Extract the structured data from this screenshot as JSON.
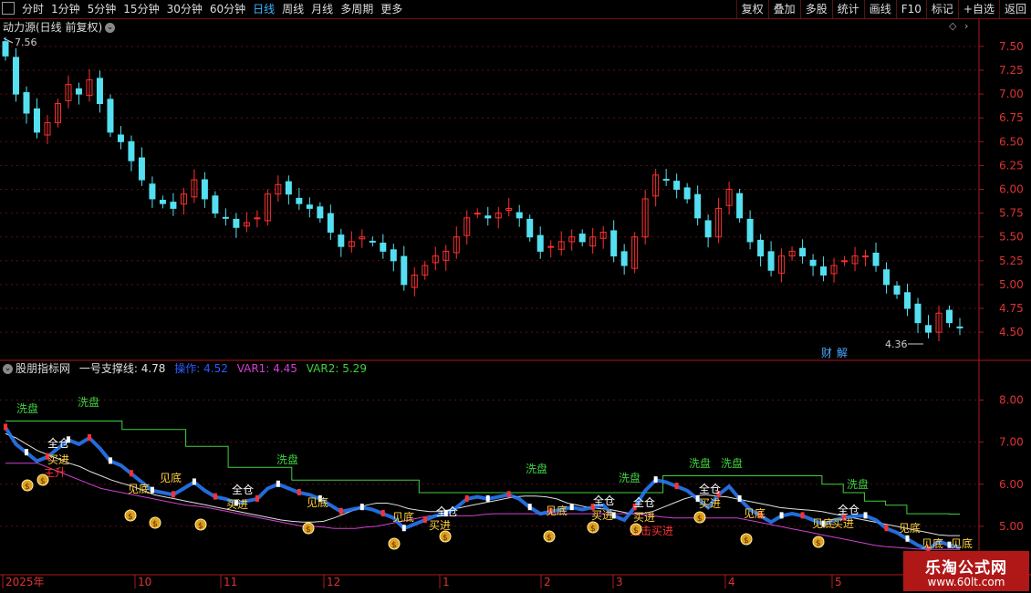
{
  "toolbar": {
    "periods": [
      "分时",
      "1分钟",
      "5分钟",
      "15分钟",
      "30分钟",
      "60分钟",
      "日线",
      "周线",
      "月线",
      "多周期",
      "更多"
    ],
    "active_period": "日线",
    "buttons": [
      "复权",
      "叠加",
      "多股",
      "统计",
      "画线",
      "F10",
      "标记",
      "+自选",
      "返回"
    ]
  },
  "main_panel": {
    "title": "动力源(日线 前复权)",
    "high_label": "7.56",
    "low_label": "4.36",
    "finance_tag": "财",
    "explain_tag": "解"
  },
  "indicator_panel": {
    "name": "股朋指标网",
    "fields": [
      {
        "label": "一号支撑线:",
        "value": "4.78",
        "color": "#e0e0e0"
      },
      {
        "label": "操作:",
        "value": "4.52",
        "color": "#2050ff"
      },
      {
        "label": "VAR1:",
        "value": "4.45",
        "color": "#d040d0"
      },
      {
        "label": "VAR2:",
        "value": "5.29",
        "color": "#40d040"
      }
    ]
  },
  "signals": {
    "wash": "洗盘",
    "full_buy_1": "全仓",
    "full_buy_2": "买进",
    "bottom": "见底",
    "rise": "主升",
    "snipe": "狙击买进",
    "bottom_cut": "见底"
  },
  "time_axis": [
    "2025年",
    "10",
    "11",
    "12",
    "1",
    "2",
    "3",
    "4",
    "5"
  ],
  "logo": {
    "name": "乐淘公式网",
    "url": "www.60lt.com"
  },
  "chart_data": [
    {
      "type": "candlestick",
      "title": "动力源(日线 前复权)",
      "y_ticks": [
        4.5,
        4.75,
        5.0,
        5.25,
        5.5,
        5.75,
        6.0,
        6.25,
        6.5,
        6.75,
        7.0,
        7.25,
        7.5
      ],
      "ylim": [
        4.3,
        7.7
      ],
      "close": [
        7.4,
        7.0,
        6.8,
        6.6,
        6.7,
        6.9,
        7.1,
        7.0,
        7.15,
        6.9,
        6.6,
        6.5,
        6.3,
        6.1,
        5.9,
        5.85,
        5.8,
        5.95,
        6.1,
        5.9,
        5.75,
        5.7,
        5.6,
        5.65,
        5.7,
        5.95,
        6.05,
        5.95,
        5.85,
        5.8,
        5.7,
        5.55,
        5.4,
        5.45,
        5.5,
        5.45,
        5.35,
        5.25,
        5.0,
        5.1,
        5.2,
        5.3,
        5.35,
        5.5,
        5.7,
        5.75,
        5.7,
        5.75,
        5.8,
        5.7,
        5.5,
        5.35,
        5.4,
        5.45,
        5.5,
        5.45,
        5.5,
        5.55,
        5.3,
        5.2,
        5.5,
        5.9,
        6.15,
        6.1,
        6.0,
        5.9,
        5.7,
        5.5,
        5.8,
        6.0,
        5.7,
        5.45,
        5.3,
        5.15,
        5.3,
        5.35,
        5.3,
        5.2,
        5.1,
        5.2,
        5.25,
        5.3,
        5.3,
        5.2,
        5.0,
        4.9,
        4.75,
        4.6,
        4.5,
        4.7,
        4.6,
        4.55
      ],
      "ohlc_note": "daily candles, red up / cyan down"
    },
    {
      "type": "line",
      "y_ticks": [
        5.0,
        6.0,
        7.0,
        8.0
      ],
      "ylim": [
        4.5,
        8.4
      ],
      "series": [
        {
          "name": "一号支撑线",
          "color": "#e0e0e0",
          "values": [
            7.2,
            7.1,
            6.95,
            6.8,
            6.7,
            6.6,
            6.5,
            6.42,
            6.3,
            6.2,
            6.1,
            6.02,
            5.95,
            5.85,
            5.75,
            5.7,
            5.65,
            5.6,
            5.55,
            5.5,
            5.45,
            5.4,
            5.35,
            5.3,
            5.25,
            5.2,
            5.15,
            5.12,
            5.1,
            5.1,
            5.12,
            5.2,
            5.3,
            5.4,
            5.5,
            5.55,
            5.55,
            5.5,
            5.42,
            5.38,
            5.35,
            5.35,
            5.4,
            5.45,
            5.5,
            5.55,
            5.6,
            5.65,
            5.7,
            5.72,
            5.72,
            5.7,
            5.65,
            5.55,
            5.5,
            5.45,
            5.42,
            5.4,
            5.35,
            5.3,
            5.3,
            5.35,
            5.45,
            5.55,
            5.65,
            5.72,
            5.75,
            5.72,
            5.7,
            5.65,
            5.6,
            5.55,
            5.5,
            5.45,
            5.42,
            5.4,
            5.38,
            5.35,
            5.3,
            5.25,
            5.2,
            5.15,
            5.1,
            5.05,
            5.0,
            4.95,
            4.9,
            4.85,
            4.8,
            4.78,
            4.78
          ]
        },
        {
          "name": "VAR1",
          "color": "#d040d0",
          "values": [
            6.5,
            6.5,
            6.5,
            6.5,
            6.4,
            6.3,
            6.2,
            6.1,
            6.0,
            5.9,
            5.85,
            5.8,
            5.75,
            5.7,
            5.65,
            5.6,
            5.55,
            5.5,
            5.48,
            5.45,
            5.4,
            5.35,
            5.3,
            5.25,
            5.2,
            5.15,
            5.1,
            5.05,
            5.0,
            5.0,
            4.98,
            4.95,
            4.95,
            4.95,
            4.98,
            5.0,
            5.05,
            5.1,
            5.15,
            5.2,
            5.25,
            5.25,
            5.25,
            5.25,
            5.25,
            5.28,
            5.3,
            5.3,
            5.3,
            5.3,
            5.3,
            5.3,
            5.3,
            5.3,
            5.3,
            5.3,
            5.3,
            5.3,
            5.3,
            5.3,
            5.28,
            5.25,
            5.22,
            5.2,
            5.2,
            5.2,
            5.2,
            5.2,
            5.2,
            5.2,
            5.15,
            5.1,
            5.05,
            5.0,
            4.95,
            4.9,
            4.85,
            4.8,
            4.75,
            4.7,
            4.65,
            4.6,
            4.55,
            4.52,
            4.5,
            4.48,
            4.46,
            4.45,
            4.45,
            4.45,
            4.45
          ]
        },
        {
          "name": "VAR2",
          "color": "#40d040",
          "values": [
            7.5,
            7.5,
            7.5,
            7.5,
            7.5,
            7.5,
            7.5,
            7.5,
            7.5,
            7.5,
            7.5,
            7.3,
            7.3,
            7.3,
            7.3,
            7.3,
            7.3,
            6.9,
            6.9,
            6.9,
            6.9,
            6.4,
            6.4,
            6.4,
            6.4,
            6.4,
            6.4,
            6.1,
            6.1,
            6.1,
            6.1,
            6.1,
            6.1,
            6.1,
            6.1,
            6.1,
            6.1,
            6.1,
            6.1,
            5.8,
            5.8,
            5.8,
            5.8,
            5.8,
            5.8,
            5.8,
            5.8,
            5.8,
            5.8,
            5.8,
            5.8,
            5.8,
            5.8,
            5.8,
            5.8,
            5.8,
            5.8,
            5.8,
            5.8,
            5.8,
            5.8,
            5.8,
            6.2,
            6.2,
            6.2,
            6.2,
            6.2,
            6.2,
            6.2,
            6.2,
            6.2,
            6.2,
            6.2,
            6.2,
            6.2,
            6.2,
            6.2,
            6.0,
            6.0,
            5.8,
            5.8,
            5.6,
            5.6,
            5.5,
            5.5,
            5.3,
            5.3,
            5.3,
            5.3,
            5.29,
            5.29
          ]
        }
      ]
    }
  ]
}
